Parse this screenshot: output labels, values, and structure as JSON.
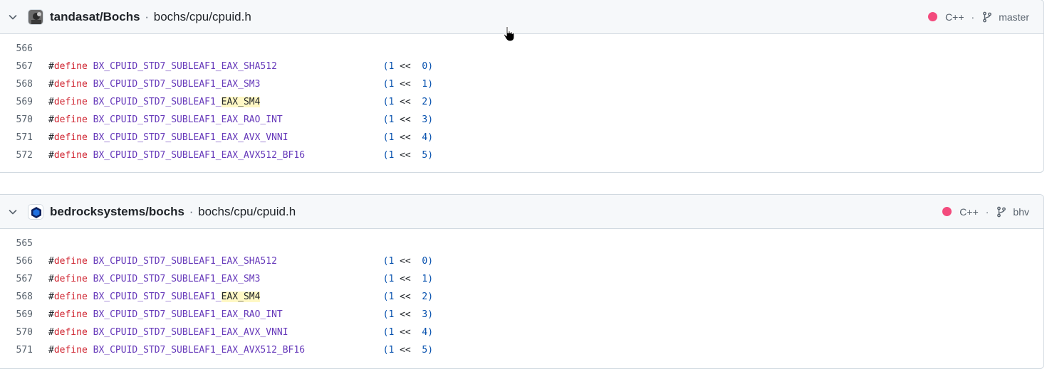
{
  "results": [
    {
      "repo": "tandasat/Bochs",
      "separator": "·",
      "path": "bochs/cpu/cpuid.h",
      "language": "C++",
      "language_color": "#f34b7d",
      "meta_sep": "·",
      "branch": "master",
      "lines": [
        {
          "n": "566",
          "blank": true
        },
        {
          "n": "567",
          "hash": "#",
          "kw": "define",
          "pre": "BX_CPUID_STD7_SUBLEAF1_EAX_SHA512",
          "hl": "",
          "post": "",
          "lp": "(",
          "one": "1",
          "op": " <<  ",
          "bit": "0",
          "rp": ")"
        },
        {
          "n": "568",
          "hash": "#",
          "kw": "define",
          "pre": "BX_CPUID_STD7_SUBLEAF1_EAX_SM3",
          "hl": "",
          "post": "",
          "lp": "(",
          "one": "1",
          "op": " <<  ",
          "bit": "1",
          "rp": ")"
        },
        {
          "n": "569",
          "hash": "#",
          "kw": "define",
          "pre": "BX_CPUID_STD7_SUBLEAF1_",
          "hl": "EAX_SM4",
          "post": "",
          "lp": "(",
          "one": "1",
          "op": " <<  ",
          "bit": "2",
          "rp": ")"
        },
        {
          "n": "570",
          "hash": "#",
          "kw": "define",
          "pre": "BX_CPUID_STD7_SUBLEAF1_EAX_RAO_INT",
          "hl": "",
          "post": "",
          "lp": "(",
          "one": "1",
          "op": " <<  ",
          "bit": "3",
          "rp": ")"
        },
        {
          "n": "571",
          "hash": "#",
          "kw": "define",
          "pre": "BX_CPUID_STD7_SUBLEAF1_EAX_AVX_VNNI",
          "hl": "",
          "post": "",
          "lp": "(",
          "one": "1",
          "op": " <<  ",
          "bit": "4",
          "rp": ")"
        },
        {
          "n": "572",
          "hash": "#",
          "kw": "define",
          "pre": "BX_CPUID_STD7_SUBLEAF1_EAX_AVX512_BF16",
          "hl": "",
          "post": "",
          "lp": "(",
          "one": "1",
          "op": " <<  ",
          "bit": "5",
          "rp": ")"
        }
      ]
    },
    {
      "repo": "bedrocksystems/bochs",
      "separator": "·",
      "path": "bochs/cpu/cpuid.h",
      "language": "C++",
      "language_color": "#f34b7d",
      "meta_sep": "·",
      "branch": "bhv",
      "lines": [
        {
          "n": "565",
          "blank": true
        },
        {
          "n": "566",
          "hash": "#",
          "kw": "define",
          "pre": "BX_CPUID_STD7_SUBLEAF1_EAX_SHA512",
          "hl": "",
          "post": "",
          "lp": "(",
          "one": "1",
          "op": " <<  ",
          "bit": "0",
          "rp": ")"
        },
        {
          "n": "567",
          "hash": "#",
          "kw": "define",
          "pre": "BX_CPUID_STD7_SUBLEAF1_EAX_SM3",
          "hl": "",
          "post": "",
          "lp": "(",
          "one": "1",
          "op": " <<  ",
          "bit": "1",
          "rp": ")"
        },
        {
          "n": "568",
          "hash": "#",
          "kw": "define",
          "pre": "BX_CPUID_STD7_SUBLEAF1_",
          "hl": "EAX_SM4",
          "post": "",
          "lp": "(",
          "one": "1",
          "op": " <<  ",
          "bit": "2",
          "rp": ")"
        },
        {
          "n": "569",
          "hash": "#",
          "kw": "define",
          "pre": "BX_CPUID_STD7_SUBLEAF1_EAX_RAO_INT",
          "hl": "",
          "post": "",
          "lp": "(",
          "one": "1",
          "op": " <<  ",
          "bit": "3",
          "rp": ")"
        },
        {
          "n": "570",
          "hash": "#",
          "kw": "define",
          "pre": "BX_CPUID_STD7_SUBLEAF1_EAX_AVX_VNNI",
          "hl": "",
          "post": "",
          "lp": "(",
          "one": "1",
          "op": " <<  ",
          "bit": "4",
          "rp": ")"
        },
        {
          "n": "571",
          "hash": "#",
          "kw": "define",
          "pre": "BX_CPUID_STD7_SUBLEAF1_EAX_AVX512_BF16",
          "hl": "",
          "post": "",
          "lp": "(",
          "one": "1",
          "op": " <<  ",
          "bit": "5",
          "rp": ")"
        }
      ]
    }
  ]
}
